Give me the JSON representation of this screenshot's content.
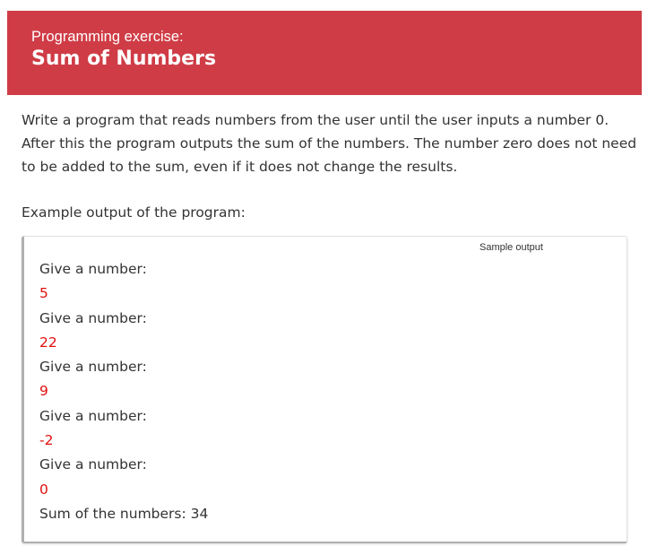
{
  "header": {
    "label": "Programming exercise:",
    "title": "Sum of Numbers",
    "background_color": "#cf3c46"
  },
  "description": "Write a program that reads numbers from the user until the user inputs a number 0. After this the program outputs the sum of the numbers. The number zero does not need to be added to the sum, even if it does not change the results.",
  "example_label": "Example output of the program:",
  "sample_output": {
    "tag": "Sample output",
    "input_color": "#e01010",
    "lines": [
      {
        "text": "Give a number:",
        "kind": "prompt"
      },
      {
        "text": "5",
        "kind": "input"
      },
      {
        "text": "Give a number:",
        "kind": "prompt"
      },
      {
        "text": "22",
        "kind": "input"
      },
      {
        "text": "Give a number:",
        "kind": "prompt"
      },
      {
        "text": "9",
        "kind": "input"
      },
      {
        "text": "Give a number:",
        "kind": "prompt"
      },
      {
        "text": "-2",
        "kind": "input"
      },
      {
        "text": "Give a number:",
        "kind": "prompt"
      },
      {
        "text": "0",
        "kind": "input"
      },
      {
        "text": "Sum of the numbers: 34",
        "kind": "result"
      }
    ]
  }
}
